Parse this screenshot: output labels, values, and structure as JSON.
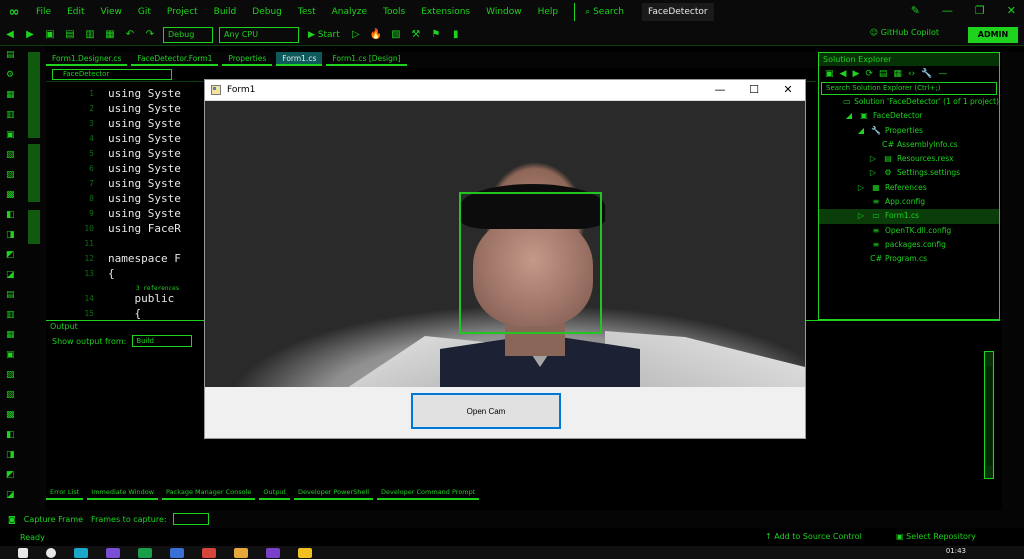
{
  "menubar": {
    "items": [
      "File",
      "Edit",
      "View",
      "Git",
      "Project",
      "Build",
      "Debug",
      "Test",
      "Analyze",
      "Tools",
      "Extensions",
      "Window",
      "Help"
    ],
    "search": "Search",
    "project_title": "FaceDetector"
  },
  "toolbar": {
    "config": "Debug",
    "platform": "Any CPU",
    "start": "Start",
    "copilot": "GitHub Copilot",
    "admin": "ADMIN"
  },
  "doc_tabs": [
    "Form1.Designer.cs",
    "FaceDetector.Form1",
    "Properties",
    "Form1.cs",
    "Form1.cs [Design]"
  ],
  "editor": {
    "file_combo": "FaceDetector",
    "lines": [
      {
        "n": "1",
        "text": "using Syste"
      },
      {
        "n": "2",
        "text": "using Syste"
      },
      {
        "n": "3",
        "text": "using Syste"
      },
      {
        "n": "4",
        "text": "using Syste"
      },
      {
        "n": "5",
        "text": "using Syste"
      },
      {
        "n": "6",
        "text": "using Syste"
      },
      {
        "n": "7",
        "text": "using Syste"
      },
      {
        "n": "8",
        "text": "using Syste"
      },
      {
        "n": "9",
        "text": "using Syste"
      },
      {
        "n": "10",
        "text": "using FaceR"
      },
      {
        "n": "11",
        "text": ""
      },
      {
        "n": "12",
        "text": "namespace F"
      },
      {
        "n": "13",
        "text": "{"
      },
      {
        "n": "14",
        "text": "    public "
      },
      {
        "n": "15",
        "text": "    {"
      }
    ],
    "refs": "3 references"
  },
  "output": {
    "title": "Output",
    "show_from_label": "Show output from:",
    "show_from_value": "Build"
  },
  "bottom_tabs": [
    "Error List",
    "Immediate Window",
    "Package Manager Console",
    "Output",
    "Developer PowerShell",
    "Developer Command Prompt"
  ],
  "capture_bar": {
    "capture_frame": "Capture Frame",
    "frames_to_capture": "Frames to capture:"
  },
  "statusbar": {
    "ready": "Ready",
    "add_source_control": "Add to Source Control",
    "select_repository": "Select Repository"
  },
  "taskbar": {
    "time": "01:43"
  },
  "solution_explorer": {
    "title": "Solution Explorer",
    "search_placeholder": "Search Solution Explorer (Ctrl+;)",
    "items": [
      {
        "label": "Solution 'FaceDetector' (1 of 1 project)",
        "icon": "▭",
        "indent": 1
      },
      {
        "label": "FaceDetector",
        "icon": "▣",
        "indent": 2,
        "arrow": "◢"
      },
      {
        "label": "Properties",
        "icon": "🔧",
        "indent": 3,
        "arrow": "◢"
      },
      {
        "label": "AssemblyInfo.cs",
        "icon": "C#",
        "indent": 4
      },
      {
        "label": "Resources.resx",
        "icon": "▤",
        "indent": 4,
        "arrow": "▷"
      },
      {
        "label": "Settings.settings",
        "icon": "⚙",
        "indent": 4,
        "arrow": "▷"
      },
      {
        "label": "References",
        "icon": "▦",
        "indent": 3,
        "arrow": "▷"
      },
      {
        "label": "App.config",
        "icon": "≡",
        "indent": 3
      },
      {
        "label": "Form1.cs",
        "icon": "▭",
        "indent": 3,
        "arrow": "▷",
        "selected": true
      },
      {
        "label": "OpenTK.dll.config",
        "icon": "≡",
        "indent": 3
      },
      {
        "label": "packages.config",
        "icon": "≡",
        "indent": 3
      },
      {
        "label": "Program.cs",
        "icon": "C#",
        "indent": 3
      }
    ]
  },
  "form1": {
    "title": "Form1",
    "open_cam": "Open Cam"
  },
  "colors": {
    "accent": "#1ed21e",
    "background": "#000000",
    "face_box": "#22c522",
    "button_focus": "#0078d7"
  }
}
